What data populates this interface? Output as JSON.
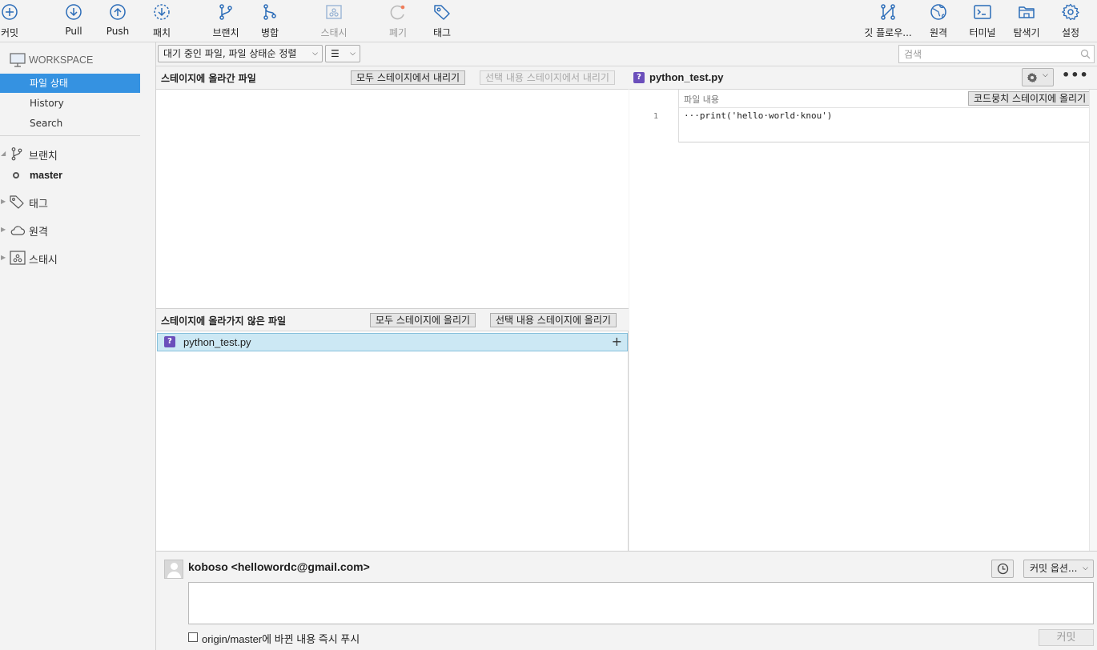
{
  "toolbar": {
    "commit": "커밋",
    "pull": "Pull",
    "push": "Push",
    "patch": "패치",
    "branch": "브랜치",
    "merge": "병합",
    "stash": "스태시",
    "discard": "폐기",
    "tag": "태그",
    "gitflow": "깃 플로우...",
    "remote": "원격",
    "terminal": "터미널",
    "explorer": "탐색기",
    "settings": "설정"
  },
  "sidebar": {
    "workspace": "WORKSPACE",
    "items": [
      "파일 상태",
      "History",
      "Search"
    ],
    "selected": "파일 상태",
    "groups": {
      "branches": "브랜치",
      "current_branch": "master",
      "tags": "태그",
      "remotes": "원격",
      "stashes": "스태시"
    }
  },
  "filter": {
    "sort": "대기 중인 파일, 파일 상태순 정렬",
    "view_icon": "☰",
    "search_placeholder": "검색"
  },
  "staged": {
    "title": "스테이지에 올라간 파일",
    "unstage_all": "모두 스테이지에서 내리기",
    "unstage_selected": "선택 내용 스테이지에서 내리기"
  },
  "unstaged": {
    "title": "스테이지에 올라가지 않은 파일",
    "stage_all": "모두 스테이지에 올리기",
    "stage_selected": "선택 내용 스테이지에 올리기",
    "files": [
      {
        "name": "python_test.py",
        "status": "untracked"
      }
    ]
  },
  "diff": {
    "filename": "python_test.py",
    "hunk_label": "파일 내용",
    "stage_hunk": "코드뭉치 스테이지에 올리기",
    "more": "•••",
    "lines": [
      {
        "no": "1",
        "text": "···print('hello·world·knou')"
      }
    ]
  },
  "commit": {
    "author": "koboso <hellowordc@gmail.com>",
    "options": "커밋 옵션...",
    "push_label": "origin/master에 바뀐 내용 즉시 푸시",
    "push_checked": false,
    "commit_button": "커밋"
  },
  "colors": {
    "accent": "#3592e1",
    "toolbar_icon": "#2b6cb8",
    "selection_row": "#cce8f4",
    "untracked_badge": "#6b4fbb"
  }
}
